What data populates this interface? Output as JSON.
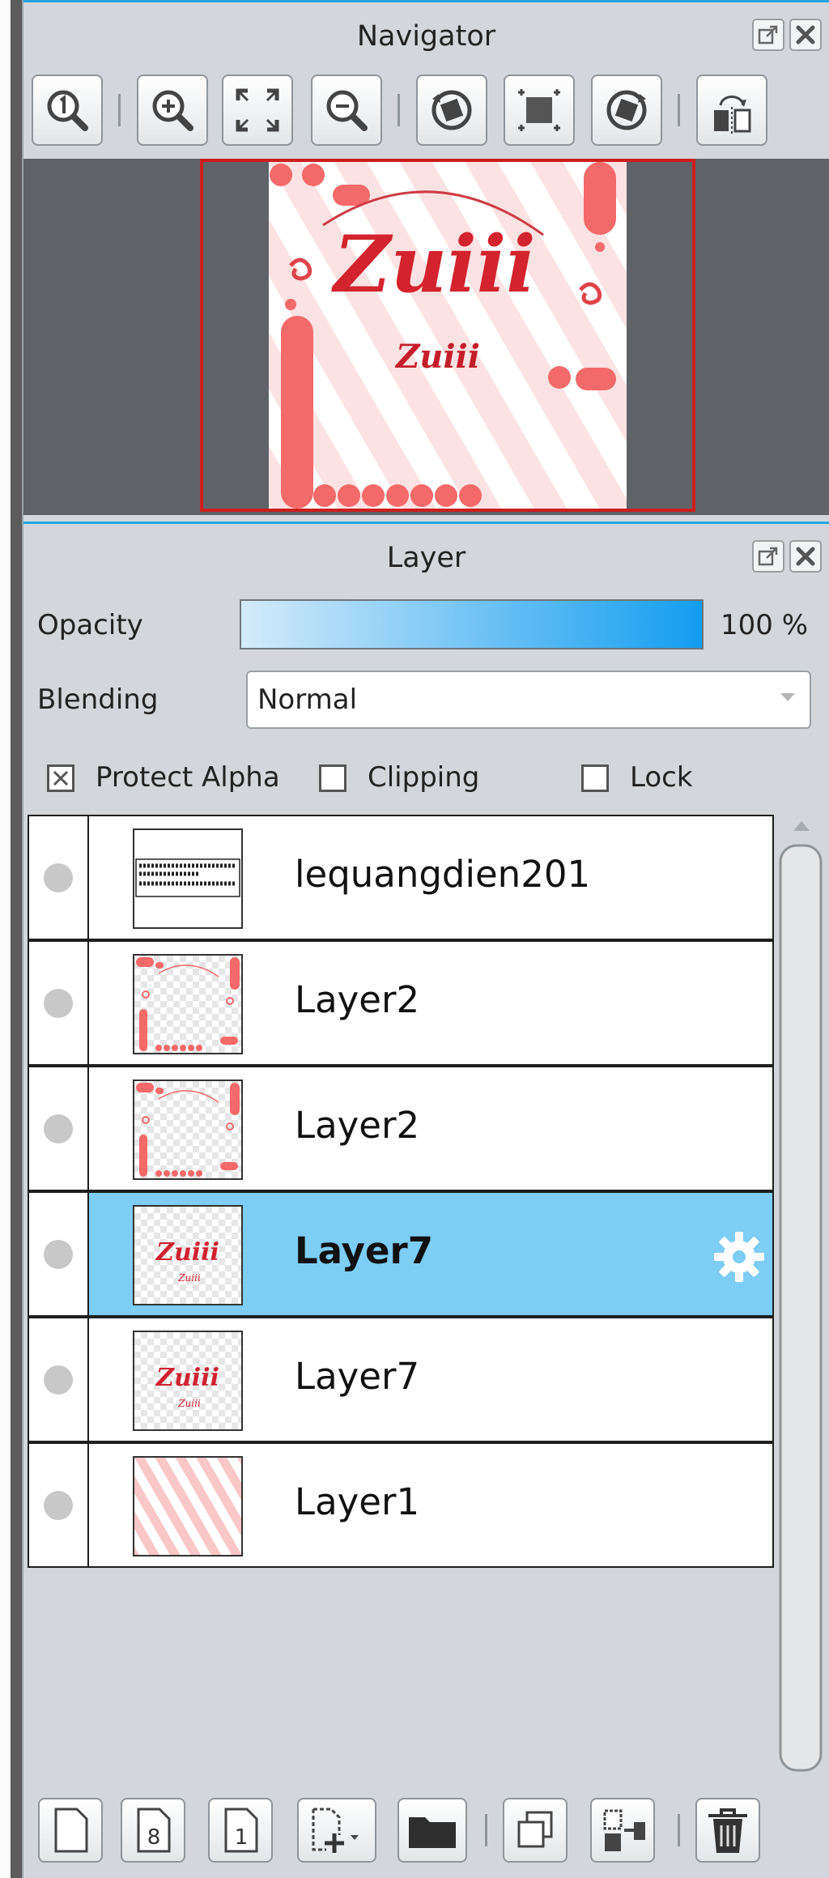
{
  "navigator": {
    "title": "Navigator",
    "tools": [
      "zoom-actual-icon",
      "zoom-in-icon",
      "fit-screen-icon",
      "zoom-out-icon",
      "rotate-left-icon",
      "reset-view-icon",
      "rotate-right-icon",
      "flip-horizontal-icon"
    ],
    "preview": {
      "main_text": "Zuiii",
      "sub_text": "Zuiii"
    }
  },
  "layer_panel": {
    "title": "Layer",
    "opacity_label": "Opacity",
    "opacity_value": "100 %",
    "opacity": 1.0,
    "blending_label": "Blending",
    "blending_value": "Normal",
    "protect_alpha_label": "Protect Alpha",
    "protect_alpha_checked": true,
    "clipping_label": "Clipping",
    "clipping_checked": false,
    "lock_label": "Lock",
    "lock_checked": false,
    "layers": [
      {
        "name": "lequangdien201",
        "selected": false,
        "thumb": "text"
      },
      {
        "name": "Layer2",
        "selected": false,
        "thumb": "frame"
      },
      {
        "name": "Layer2",
        "selected": false,
        "thumb": "frame"
      },
      {
        "name": "Layer7",
        "selected": true,
        "thumb": "zuiii"
      },
      {
        "name": "Layer7",
        "selected": false,
        "thumb": "zuiii"
      },
      {
        "name": "Layer1",
        "selected": false,
        "thumb": "stripes"
      }
    ],
    "bottom_tools": [
      "new-layer-icon",
      "new-8bit-layer-icon",
      "new-1bit-layer-icon",
      "add-layer-menu-icon",
      "folder-icon",
      "duplicate-layer-icon",
      "merge-down-icon",
      "delete-layer-icon"
    ]
  },
  "colors": {
    "accent": "#29a3e0",
    "selected_row": "#7dcdf5",
    "frame": "#cc1f1f",
    "pink": "#f4696a"
  }
}
